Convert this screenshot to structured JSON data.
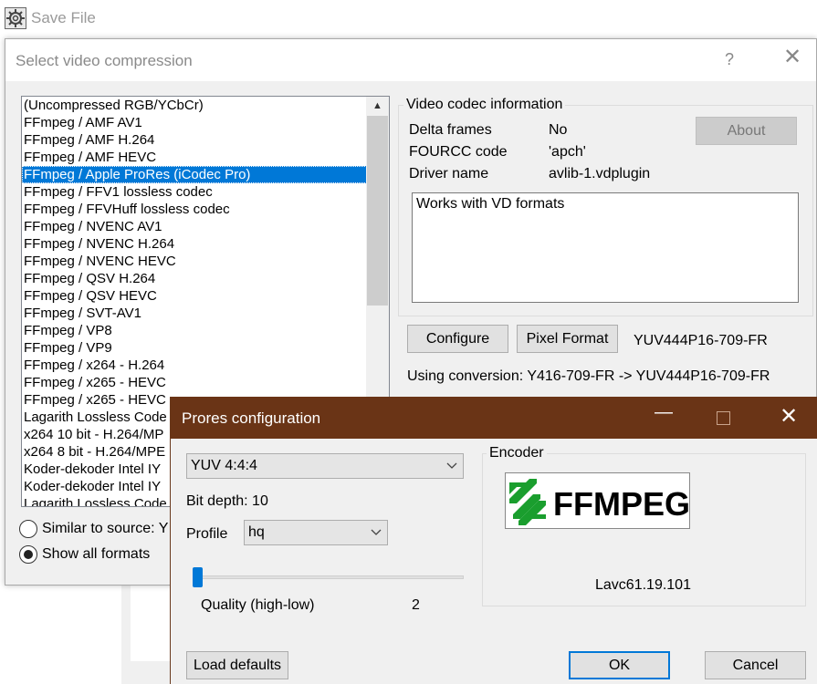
{
  "save_file": {
    "title": "Save File"
  },
  "video_compression": {
    "title": "Select video compression",
    "help_label": "?",
    "codecs": [
      "(Uncompressed RGB/YCbCr)",
      "FFmpeg / AMF AV1",
      "FFmpeg / AMF H.264",
      "FFmpeg / AMF HEVC",
      "FFmpeg / Apple ProRes (iCodec Pro)",
      "FFmpeg / FFV1 lossless codec",
      "FFmpeg / FFVHuff lossless codec",
      "FFmpeg / NVENC AV1",
      "FFmpeg / NVENC H.264",
      "FFmpeg / NVENC HEVC",
      "FFmpeg / QSV H.264",
      "FFmpeg / QSV HEVC",
      "FFmpeg / SVT-AV1",
      "FFmpeg / VP8",
      "FFmpeg / VP9",
      "FFmpeg / x264 - H.264",
      "FFmpeg / x265 - HEVC",
      "FFmpeg / x265 - HEVC",
      "Lagarith Lossless Code",
      "x264 10 bit - H.264/MP",
      "x264 8 bit - H.264/MPE",
      "Koder-dekoder Intel IY",
      "Koder-dekoder Intel IY",
      "Lagarith Lossless Code"
    ],
    "selected_index": 4,
    "radio_similar": "Similar to source: Y",
    "radio_all": "Show all formats",
    "info": {
      "group_title": "Video codec information",
      "delta_frames_key": "Delta frames",
      "delta_frames_val": "No",
      "fourcc_key": "FOURCC code",
      "fourcc_val": "'apch'",
      "driver_key": "Driver name",
      "driver_val": "avlib-1.vdplugin",
      "about_label": "About",
      "description": "Works with VD formats"
    },
    "configure_label": "Configure",
    "pixel_format_label": "Pixel Format",
    "pixel_format_value": "YUV444P16-709-FR",
    "conversion_text": "Using conversion: Y416-709-FR -> YUV444P16-709-FR"
  },
  "prores": {
    "title": "Prores configuration",
    "format_value": "YUV 4:4:4",
    "bit_depth_text": "Bit depth: 10",
    "profile_label": "Profile",
    "profile_value": "hq",
    "quality_label": "Quality (high-low)",
    "quality_value": "2",
    "encoder_title": "Encoder",
    "logo_text": "FFMPEG",
    "encoder_version": "Lavc61.19.101",
    "load_defaults_label": "Load defaults",
    "ok_label": "OK",
    "cancel_label": "Cancel"
  }
}
